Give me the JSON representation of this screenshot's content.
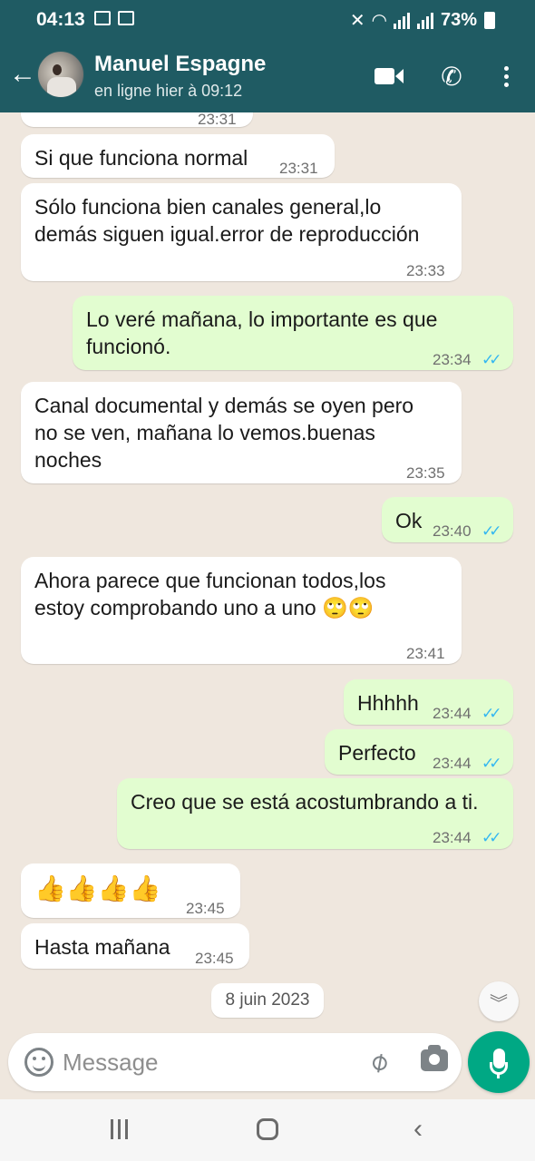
{
  "status_bar": {
    "time": "04:13",
    "battery": "73%"
  },
  "header": {
    "contact_name": "Manuel Espagne",
    "contact_status": "en ligne hier à 09:12"
  },
  "messages": [
    {
      "direction": "in",
      "text": "Si que funciona normal",
      "time": "23:31"
    },
    {
      "direction": "in",
      "text": "Sólo funciona bien canales general,lo\ndemás siguen igual.error de reproducción",
      "time": "23:33"
    },
    {
      "direction": "out",
      "text": "Lo veré mañana, lo importante es que\nfuncionó.",
      "time": "23:34",
      "read": true
    },
    {
      "direction": "in",
      "text": "Canal documental y demás se oyen pero\nno se ven, mañana lo vemos.buenas\nnoches",
      "time": "23:35"
    },
    {
      "direction": "out",
      "text": "Ok",
      "time": "23:40",
      "read": true
    },
    {
      "direction": "in",
      "text": "Ahora parece que funcionan todos,los\nestoy comprobando uno a uno 🙄🙄",
      "time": "23:41"
    },
    {
      "direction": "out",
      "text": "Hhhhh",
      "time": "23:44",
      "read": true
    },
    {
      "direction": "out",
      "text": "Perfecto",
      "time": "23:44",
      "read": true
    },
    {
      "direction": "out",
      "text": "Creo que se está acostumbrando a ti.",
      "time": "23:44",
      "read": true
    },
    {
      "direction": "in",
      "text": "👍👍👍👍",
      "time": "23:45"
    },
    {
      "direction": "in",
      "text": "Hasta mañana",
      "time": "23:45"
    }
  ],
  "partial_top_time": "23:31",
  "date_chip": "8 juin 2023",
  "composer": {
    "placeholder": "Message"
  }
}
